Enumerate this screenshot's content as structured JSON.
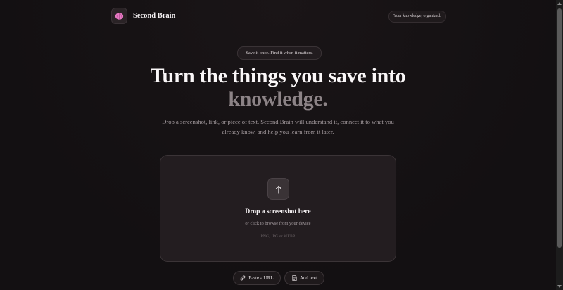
{
  "header": {
    "app_name": "Second Brain",
    "logo_icon": "brain-icon",
    "badge": "Your knowledge, organized."
  },
  "hero": {
    "tagline": "Save it once. Find it when it matters.",
    "title_main": "Turn the things you save into",
    "title_accent": "knowledge.",
    "description": "Drop a screenshot, link, or piece of text. Second Brain will understand it, connect it to what you already know, and help you learn from it later."
  },
  "dropzone": {
    "icon": "upload-arrow-icon",
    "title": "Drop a screenshot here",
    "subtitle": "or click to browse from your device",
    "formats": "PNG, JPG or WEBP"
  },
  "actions": [
    {
      "label": "Paste a URL",
      "icon": "link-icon"
    },
    {
      "label": "Add text",
      "icon": "document-icon"
    }
  ],
  "colors": {
    "background": "#141012",
    "accent_text": "#8c8386",
    "logo_pink": "#e879c4"
  }
}
